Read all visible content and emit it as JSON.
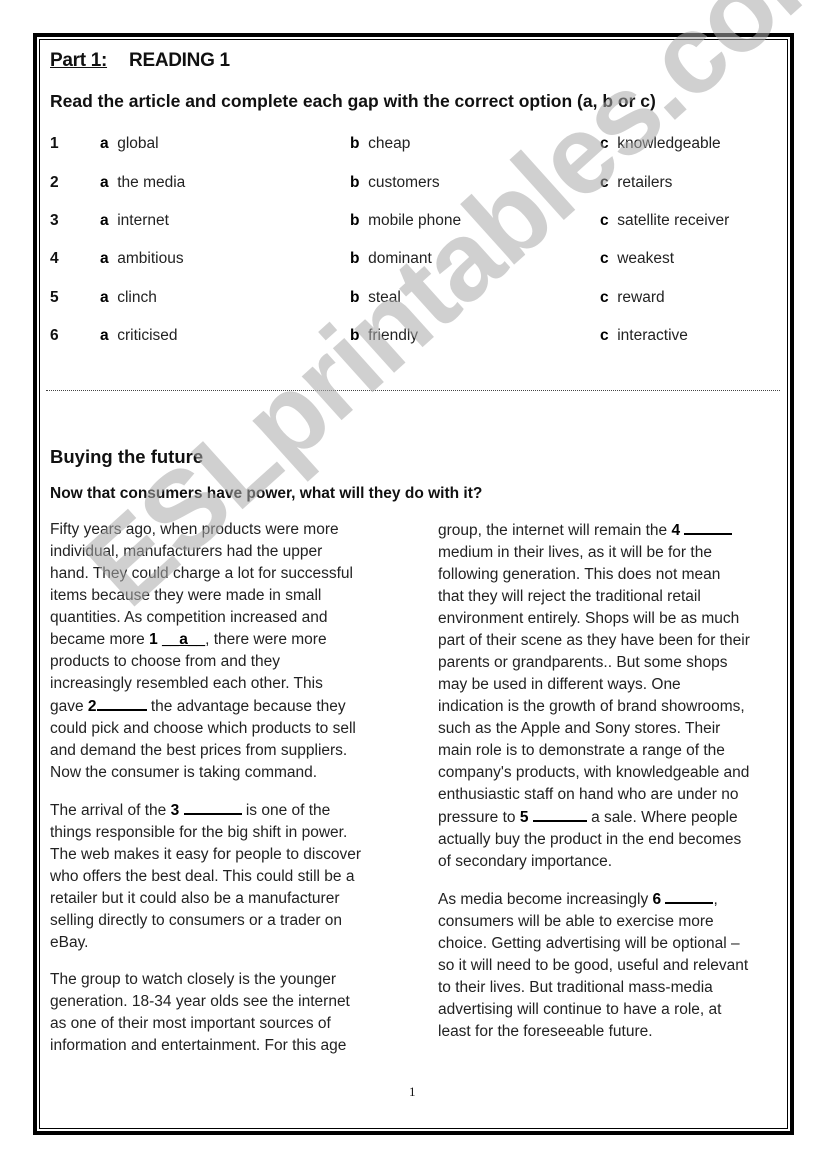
{
  "header": {
    "part_label": "Part 1:",
    "section_label": "READING 1",
    "instruction": "Read the article and complete each gap with the correct option (a, b or c)"
  },
  "options": [
    {
      "num": "1",
      "a": "global",
      "b": "cheap",
      "c": "knowledgeable"
    },
    {
      "num": "2",
      "a": "the media",
      "b": "customers",
      "c": "retailers"
    },
    {
      "num": "3",
      "a": "internet",
      "b": "mobile phone",
      "c": "satellite receiver"
    },
    {
      "num": "4",
      "a": "ambitious",
      "b": "dominant",
      "c": "weakest"
    },
    {
      "num": "5",
      "a": "clinch",
      "b": "steal",
      "c": "reward"
    },
    {
      "num": "6",
      "a": "criticised",
      "b": "friendly",
      "c": "interactive"
    }
  ],
  "letters": {
    "a": "a",
    "b": "b",
    "c": "c"
  },
  "article": {
    "title": "Buying the future",
    "subtitle": "Now that consumers have power, what will they do with it?",
    "left": {
      "p1": [
        "Fifty years ago, when products were more",
        "individual, manufacturers had the upper",
        "hand.  They could charge a lot for successful",
        "items because they were made in small",
        "quantities.  As competition increased and"
      ],
      "p1_gap_pre": "became more ",
      "p1_gap_num": "1",
      "p1_gap_answer": "__a__",
      "p1_gap_post": ", there were more",
      "p1b": [
        "products to choose from and they",
        "increasingly resembled each other.  This"
      ],
      "p1_gap2_pre": "gave ",
      "p1_gap2_num": "2",
      "p1_gap2_post": " the advantage because they",
      "p1c": [
        "could pick and choose which products to sell",
        "and demand the best prices from suppliers.",
        "Now the consumer is taking command."
      ],
      "p2_gap_pre": "The arrival of the ",
      "p2_gap_num": "3",
      "p2_gap_post": " is one of the",
      "p2": [
        "things responsible for the big shift in power.",
        "The web makes it easy for people to discover",
        "who offers the best deal.  This could still be a",
        "retailer but it could also be a manufacturer",
        "selling directly to consumers or a trader on",
        "eBay."
      ],
      "p3": [
        "The group to watch closely is the younger",
        "generation.  18-34 year olds see the internet",
        "as one of their most important sources of",
        "information and entertainment.  For this age"
      ]
    },
    "right": {
      "p1_gap_pre": "group, the internet will remain the ",
      "p1_gap_num": "4",
      "p1": [
        "medium in their lives, as it will be for the",
        "following generation.  This does not mean",
        "that they will reject the traditional retail",
        "environment entirely.  Shops will be as much",
        "part of their scene as they have been for their",
        "parents or grandparents..  But some shops",
        "may be used in different ways.  One",
        "indication is the growth of brand showrooms,",
        "such as the Apple and Sony stores.  Their",
        "main role is to demonstrate a range of the",
        "company's products, with knowledgeable and",
        "enthusiastic staff on hand who are under no"
      ],
      "p1_gap2_pre": "pressure to ",
      "p1_gap2_num": "5",
      "p1_gap2_post": " a sale.  Where people",
      "p1b": [
        "actually buy the product in the end becomes",
        "of secondary importance."
      ],
      "p2_gap_pre": "As media become increasingly ",
      "p2_gap_num": "6",
      "p2_gap_post": ",",
      "p2": [
        "consumers will be able to exercise more",
        "choice.  Getting advertising will be optional –",
        "so it will need to be good, useful and relevant",
        "to their lives.  But traditional mass-media",
        "advertising will continue to have a role, at",
        "least for the foreseeable future."
      ]
    }
  },
  "footer": {
    "page_number": "1"
  },
  "watermark": {
    "text": "ESLprintables.com",
    "color": "#c8c8c8"
  }
}
